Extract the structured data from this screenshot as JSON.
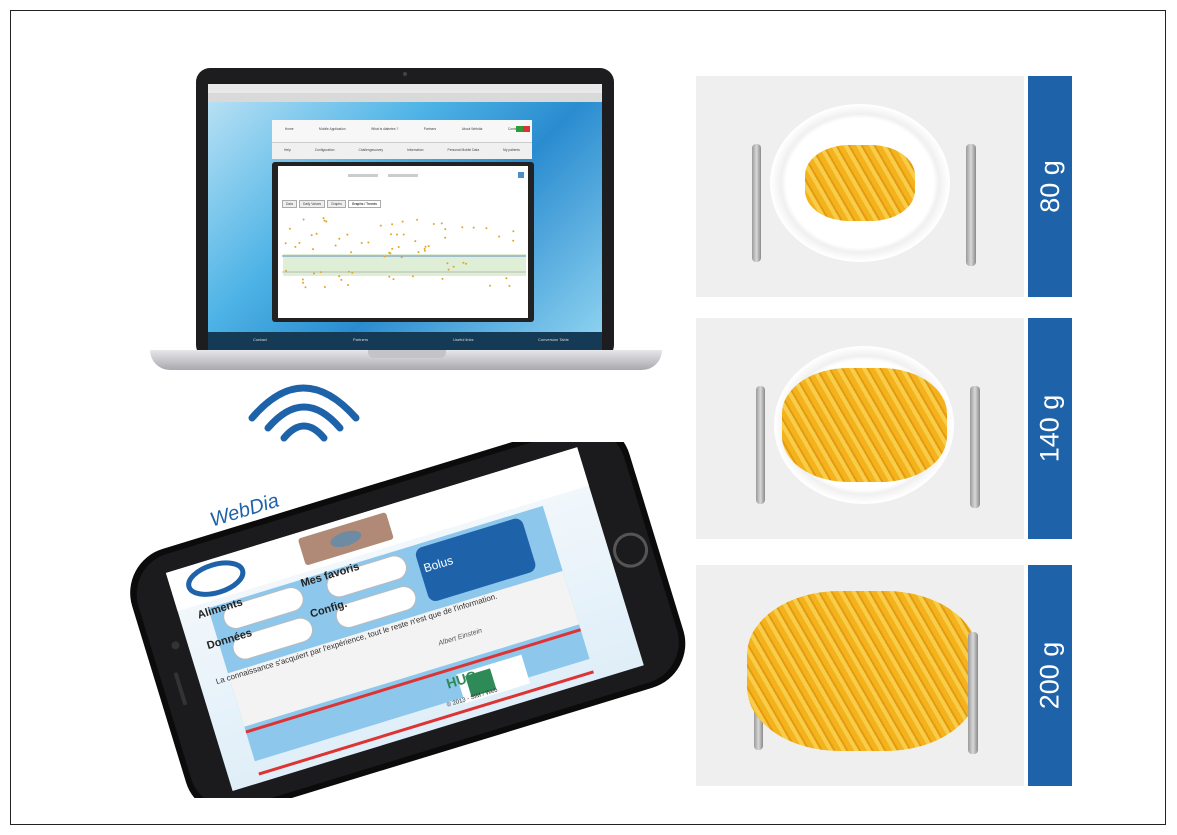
{
  "laptop": {
    "nav_top": [
      "Home",
      "Mobile Application",
      "What is diabetes ?",
      "Partners",
      "About Webdia",
      "Contact"
    ],
    "nav_bottom": [
      "Help",
      "Configuration",
      "Challengesurvey",
      "Information",
      "Personal Mobile Data",
      "My patients"
    ],
    "tabs": [
      "Data",
      "Daily Values",
      "Graphs",
      "Graphs / Trends"
    ],
    "footer": [
      "Contact",
      "Partners",
      "Useful links",
      "Conversion Table"
    ]
  },
  "phone": {
    "app_name": "WebDia",
    "buttons": [
      "Aliments",
      "Mes favoris",
      "Données",
      "Config."
    ],
    "bolus_label": "Bolus",
    "quote": "La connaissance s'acquiert par l'expérience, tout le reste n'est que de l'information.",
    "quote_author": "Albert Einstein",
    "footer_logo": "HUG",
    "copyright": "© 2013 - SIM / Web"
  },
  "portions": [
    {
      "label": "80 g",
      "amount_g": 80
    },
    {
      "label": "140 g",
      "amount_g": 140
    },
    {
      "label": "200 g",
      "amount_g": 200
    }
  ],
  "colors": {
    "label_bar": "#1e63aa",
    "plate_rim": "#1f4466",
    "fries": "#f4b31c",
    "wifi": "#1e63aa"
  }
}
